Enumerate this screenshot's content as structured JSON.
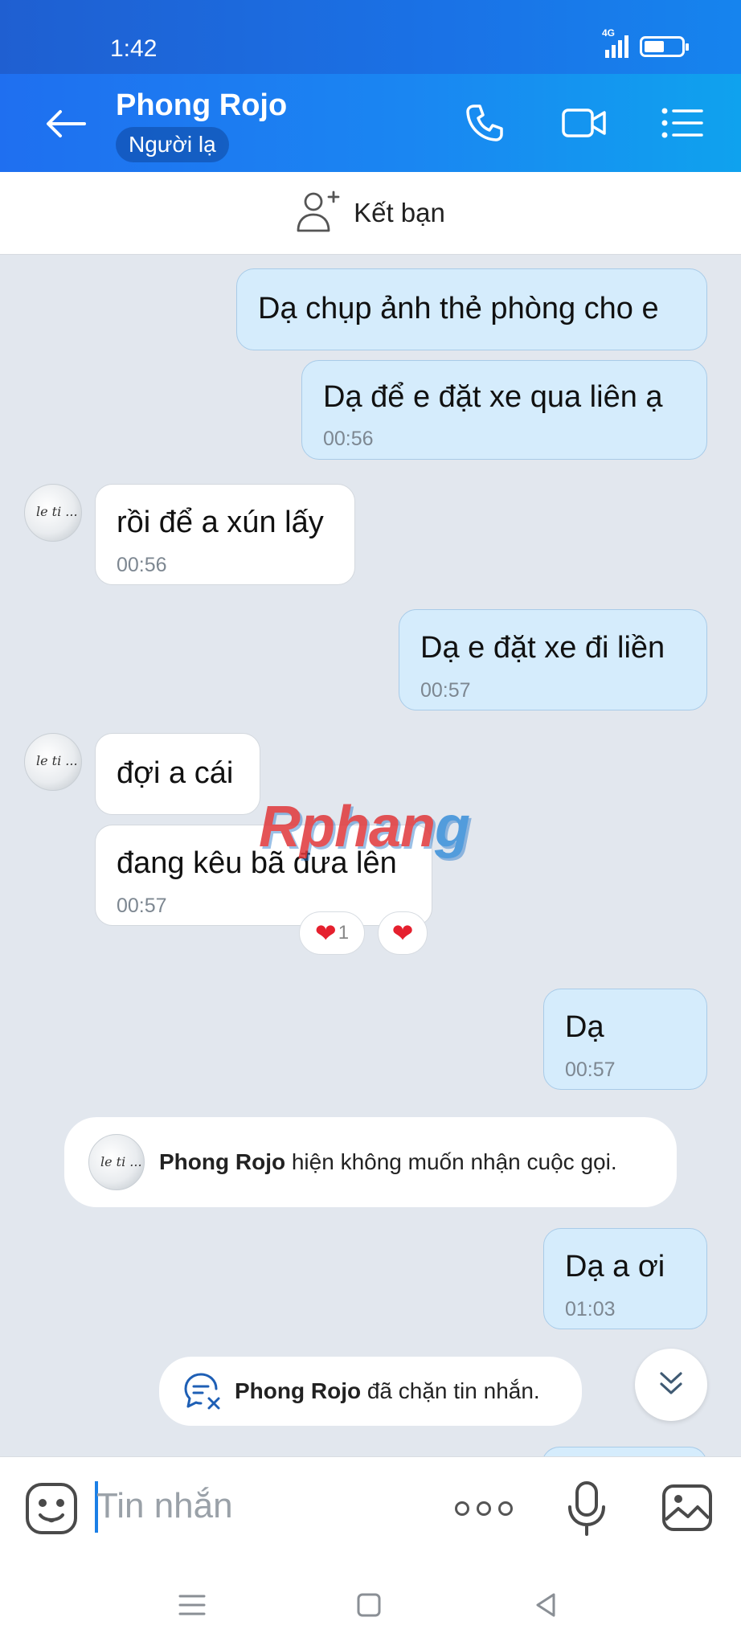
{
  "status_bar": {
    "time": "1:42",
    "network": "4G",
    "battery_level": 0.55
  },
  "header": {
    "contact_name": "Phong Rojo",
    "contact_badge": "Người lạ"
  },
  "add_friend": {
    "label": "Kết bạn"
  },
  "messages": [
    {
      "from": "me",
      "text": "Dạ chụp ảnh thẻ phòng cho e",
      "time": ""
    },
    {
      "from": "me",
      "text": "Dạ để e đặt xe qua liên ạ",
      "time": "00:56"
    },
    {
      "from": "them",
      "text": "rồi để a xún lấy",
      "time": "00:56"
    },
    {
      "from": "me",
      "text": "Dạ e đặt xe đi liền",
      "time": "00:57"
    },
    {
      "from": "them",
      "text": "đợi a cái",
      "time": ""
    },
    {
      "from": "them",
      "text": "đang kêu bã đưa lên",
      "time": "00:57"
    },
    {
      "from": "me",
      "text": "Dạ",
      "time": "00:57"
    },
    {
      "from": "me",
      "text": "Dạ a ơi",
      "time": "01:03"
    }
  ],
  "reactions": {
    "count": "1"
  },
  "system_messages": {
    "call_block": {
      "name": "Phong Rojo",
      "text": " hiện không muốn nhận cuộc gọi."
    },
    "msg_block": {
      "name": "Phong Rojo",
      "text": " đã chặn tin nhắn."
    }
  },
  "watermark": {
    "part1": "Rphan",
    "part2": "g"
  },
  "composer": {
    "placeholder": "Tin nhắn"
  },
  "colors": {
    "header_start": "#1f6ff0",
    "header_end": "#0fa2ee",
    "my_bubble": "#d5ecfc",
    "chat_bg": "#e2e7ee",
    "heart": "#e5202e"
  },
  "icons": [
    "back-arrow-icon",
    "phone-icon",
    "video-call-icon",
    "menu-list-icon",
    "add-friend-icon",
    "heart-icon",
    "blocked-message-icon",
    "chevron-double-down-icon",
    "emoji-icon",
    "more-icon",
    "mic-icon",
    "image-icon",
    "nav-menu-icon",
    "nav-home-icon",
    "nav-back-icon"
  ]
}
